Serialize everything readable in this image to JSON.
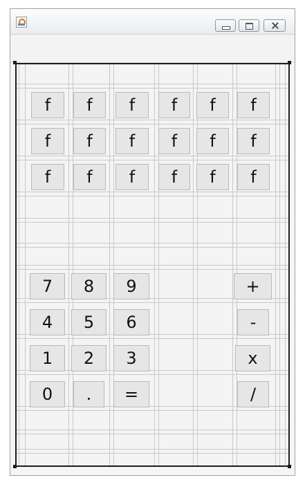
{
  "window": {
    "icon": "java-cup-icon",
    "controls": [
      "minimize-icon",
      "maximize-icon",
      "close-icon"
    ]
  },
  "keypad": {
    "function_rows": [
      [
        "f",
        "f",
        "f",
        "f",
        "f",
        "f"
      ],
      [
        "f",
        "f",
        "f",
        "f",
        "f",
        "f"
      ],
      [
        "f",
        "f",
        "f",
        "f",
        "f",
        "f"
      ]
    ],
    "rows": [
      [
        "7",
        "8",
        "9",
        "+"
      ],
      [
        "4",
        "5",
        "6",
        "-"
      ],
      [
        "1",
        "2",
        "3",
        "x"
      ],
      [
        "0",
        ".",
        "=",
        "/"
      ]
    ]
  },
  "colors": {
    "button_face": "#e6e6e6",
    "button_border": "#b9b9b9",
    "grid_line": "#c9c9c9",
    "panel_border": "#1c1c1c"
  }
}
